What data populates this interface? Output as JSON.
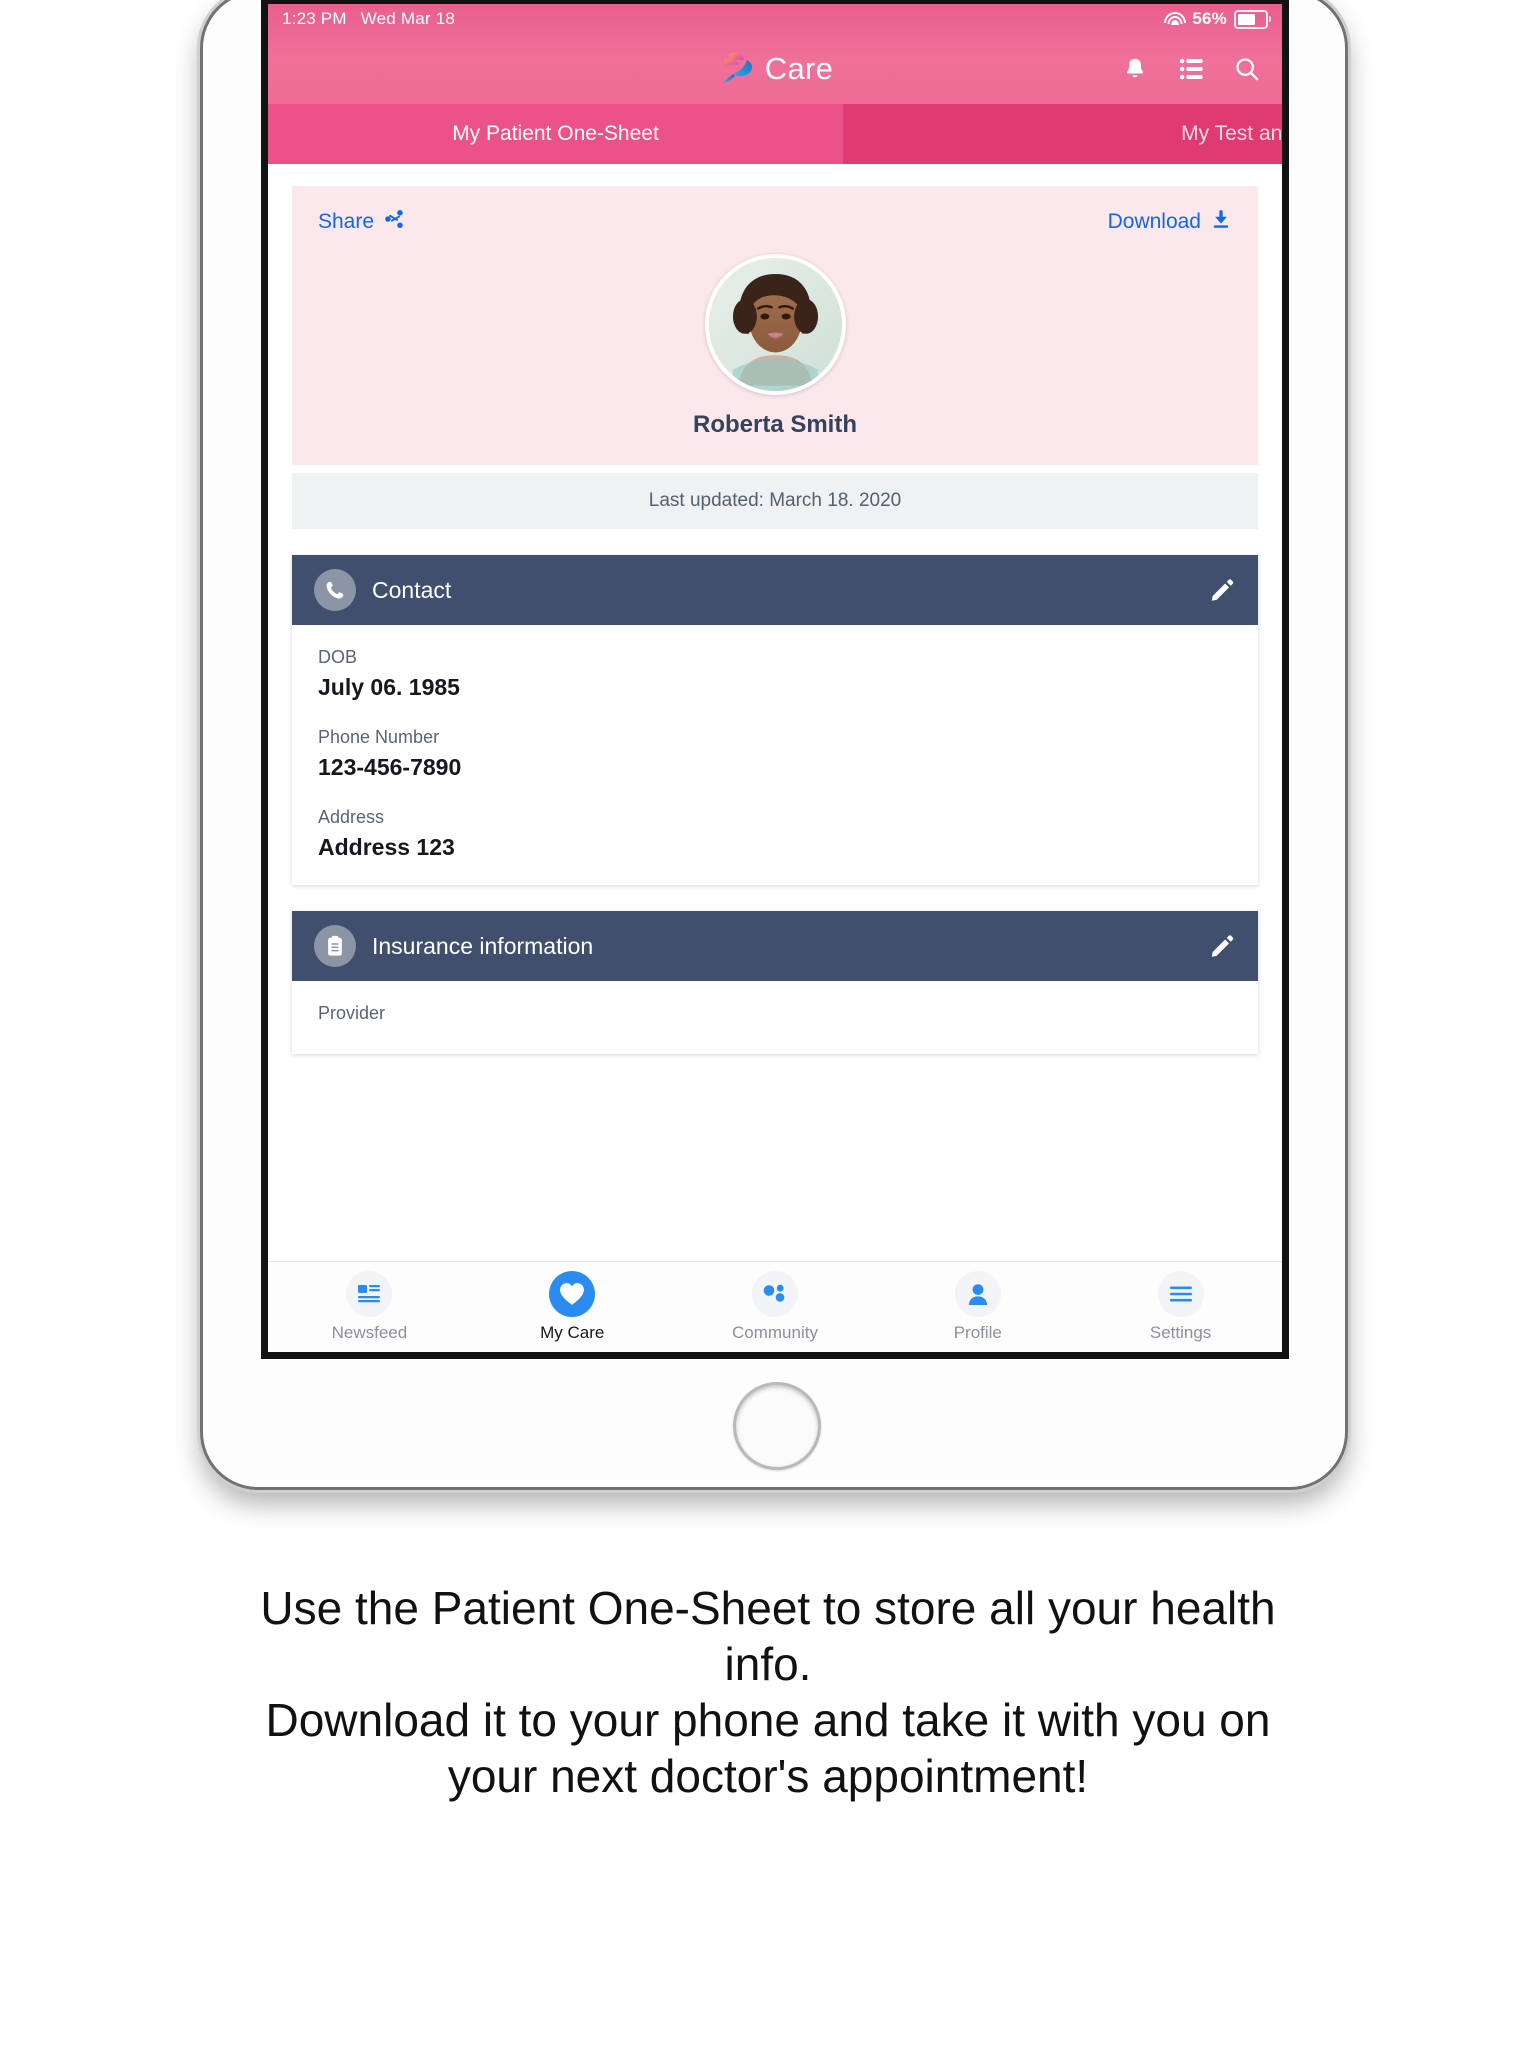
{
  "device": {
    "frame": "ipad",
    "home_button": "home-button"
  },
  "status_bar": {
    "time": "1:23 PM",
    "date": "Wed Mar 18",
    "battery_percent": "56%",
    "wifi_icon": "wifi-icon",
    "battery_icon": "battery-icon"
  },
  "app_header": {
    "brand_name": "Care",
    "logo_icon": "hummingbird-logo-icon",
    "icons": [
      "bell-icon",
      "list-icon",
      "search-icon"
    ],
    "background_color": "#ee6c96"
  },
  "tabs": [
    {
      "label": "My Patient One-Sheet",
      "active": true
    },
    {
      "label": "My Test and",
      "active": false
    }
  ],
  "hero": {
    "share_label": "Share",
    "share_icon": "share-icon",
    "download_label": "Download",
    "download_icon": "download-icon",
    "avatar": "avatar",
    "person_name": "Roberta Smith",
    "background_color": "#fbe8ed",
    "link_color": "#1565ec"
  },
  "last_updated": "Last updated: March 18. 2020",
  "sections": [
    {
      "title": "Contact",
      "icon": "phone-icon",
      "edit_icon": "pencil-icon",
      "fields": [
        {
          "label": "DOB",
          "value": "July 06. 1985"
        },
        {
          "label": "Phone Number",
          "value": "123-456-7890"
        },
        {
          "label": "Address",
          "value": "Address 123"
        }
      ]
    },
    {
      "title": "Insurance information",
      "icon": "clipboard-icon",
      "edit_icon": "pencil-icon",
      "fields": [
        {
          "label": "Provider",
          "value": ""
        }
      ]
    }
  ],
  "bottom_tabs": [
    {
      "label": "Newsfeed",
      "icon": "newsfeed-icon",
      "active": false
    },
    {
      "label": "My Care",
      "icon": "heart-icon",
      "active": true
    },
    {
      "label": "Community",
      "icon": "community-icon",
      "active": false
    },
    {
      "label": "Profile",
      "icon": "person-icon",
      "active": false
    },
    {
      "label": "Settings",
      "icon": "menu-icon",
      "active": false
    }
  ],
  "caption": {
    "line1": "Use the Patient One-Sheet to store all your health",
    "line2": "info.",
    "line3": "Download it to your phone and take it with you on",
    "line4": "your next doctor's appointment!"
  },
  "colors": {
    "header_pink": "#ee6c96",
    "tab_pink_active": "#eb5287",
    "tab_pink_inactive": "#df3a72",
    "card_header_slate": "#3f4f6d",
    "accent_blue": "#2a8cf0",
    "link_blue": "#1565ec"
  }
}
